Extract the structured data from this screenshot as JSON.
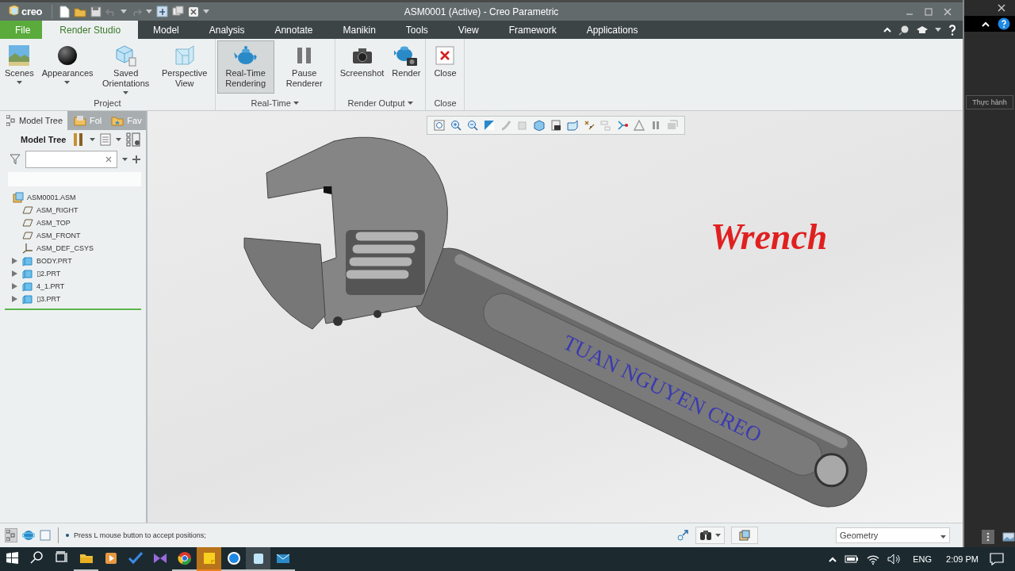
{
  "window": {
    "logo": "creo",
    "title": "ASM0001 (Active) - Creo Parametric"
  },
  "ribbon_tabs": [
    {
      "label": "File",
      "kind": "file",
      "selected": false
    },
    {
      "label": "Render Studio",
      "kind": "tab",
      "selected": true
    },
    {
      "label": "Model",
      "kind": "tab",
      "selected": false
    },
    {
      "label": "Analysis",
      "kind": "tab",
      "selected": false
    },
    {
      "label": "Annotate",
      "kind": "tab",
      "selected": false
    },
    {
      "label": "Manikin",
      "kind": "tab",
      "selected": false
    },
    {
      "label": "Tools",
      "kind": "tab",
      "selected": false
    },
    {
      "label": "View",
      "kind": "tab",
      "selected": false
    },
    {
      "label": "Framework",
      "kind": "tab",
      "selected": false
    },
    {
      "label": "Applications",
      "kind": "tab",
      "selected": false
    }
  ],
  "ribbon_groups": [
    {
      "label": "Project",
      "menu": false,
      "buttons": [
        {
          "label": "Scenes",
          "kind": "scenes",
          "menu": true,
          "selected": false
        },
        {
          "label": "Appearances",
          "kind": "appearances",
          "menu": true,
          "selected": false
        },
        {
          "label": "Saved Orientations",
          "kind": "orientations",
          "menu": true,
          "selected": false
        },
        {
          "label": "Perspective View",
          "kind": "perspective",
          "menu": false,
          "selected": false
        }
      ]
    },
    {
      "label": "Real-Time",
      "menu": true,
      "buttons": [
        {
          "label": "Real-Time Rendering",
          "kind": "teapot",
          "menu": false,
          "selected": true
        },
        {
          "label": "Pause Renderer",
          "kind": "pause",
          "menu": false,
          "selected": false
        }
      ]
    },
    {
      "label": "Render Output",
      "menu": true,
      "buttons": [
        {
          "label": "Screenshot",
          "kind": "camera",
          "menu": false,
          "selected": false
        },
        {
          "label": "Render",
          "kind": "render",
          "menu": false,
          "selected": false
        }
      ]
    },
    {
      "label": "Close",
      "menu": false,
      "buttons": [
        {
          "label": "Close",
          "kind": "close",
          "menu": false,
          "selected": false
        }
      ]
    }
  ],
  "model_tree": {
    "tabs": [
      {
        "label": "Model Tree",
        "selected": true
      },
      {
        "label": "Fol",
        "selected": false
      },
      {
        "label": "Fav",
        "selected": false
      }
    ],
    "title": "Model Tree",
    "items": [
      {
        "label": "ASM0001.ASM",
        "kind": "assembly",
        "children": [
          {
            "label": "ASM_RIGHT",
            "kind": "plane"
          },
          {
            "label": "ASM_TOP",
            "kind": "plane"
          },
          {
            "label": "ASM_FRONT",
            "kind": "plane"
          },
          {
            "label": "ASM_DEF_CSYS",
            "kind": "csys"
          },
          {
            "label": "BODY.PRT",
            "kind": "part",
            "expanded": false
          },
          {
            "label": "▯2.PRT",
            "kind": "part",
            "expanded": false
          },
          {
            "label": "4_1.PRT",
            "kind": "part",
            "expanded": false
          },
          {
            "label": "▯3.PRT",
            "kind": "part",
            "expanded": false
          }
        ]
      }
    ]
  },
  "viewport": {
    "annotations": [
      {
        "text": "Wrench",
        "kind": "title"
      },
      {
        "text": "TUAN NGUYEN CREO",
        "kind": "engraving"
      }
    ]
  },
  "status_bar": {
    "message": "Press L mouse button to accept positions;",
    "filter": "Geometry"
  },
  "side_panel": {
    "button": "Thực hành"
  },
  "taskbar": {
    "language": "ENG",
    "time": "2:09 PM"
  }
}
